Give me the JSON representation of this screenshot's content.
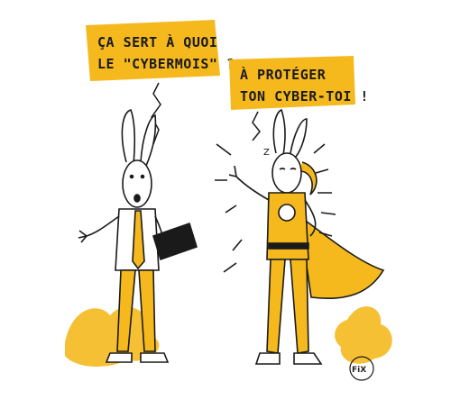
{
  "comic": {
    "left_bubble": {
      "line1": "ÇA SERT À QUOI",
      "line2": "LE \"CYBERMOIS\" ?"
    },
    "right_bubble": {
      "line1": "À PROTÉGER",
      "line2": "TON CYBER-TOI !"
    },
    "signature": "FiX",
    "colors": {
      "accent": "#F5B91E",
      "ink": "#1a1a1a",
      "background": "#ffffff"
    }
  }
}
